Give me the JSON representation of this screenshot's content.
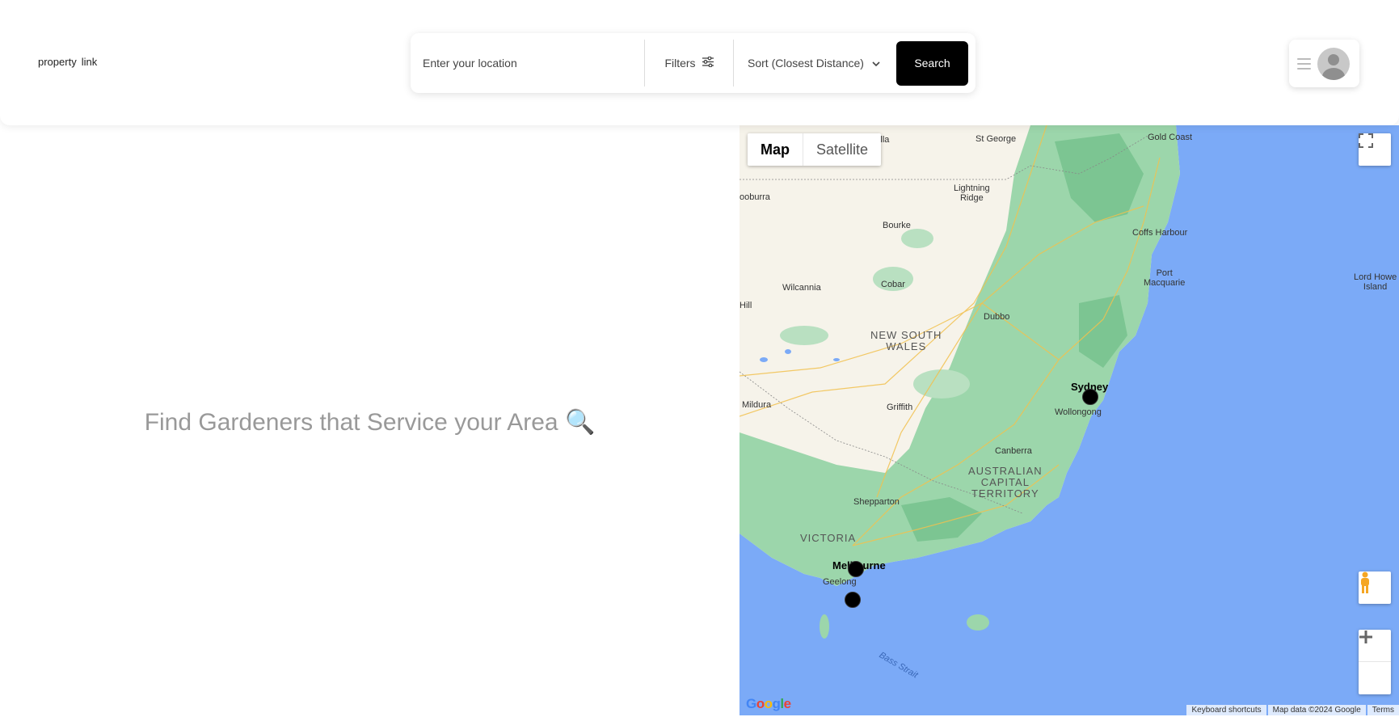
{
  "header": {
    "logo_word1": "property",
    "logo_word2": "link",
    "search_placeholder": "Enter your location",
    "filters_label": "Filters",
    "sort_label": "Sort (Closest Distance)",
    "search_button": "Search"
  },
  "main": {
    "tagline": "Find Gardeners that Service your Area 🔍"
  },
  "map": {
    "type_map": "Map",
    "type_satellite": "Satellite",
    "labels": {
      "gold_coast": "Gold Coast",
      "st_george": "St George",
      "cunnamulla": "amulla",
      "lightning_ridge": "Lightning\nRidge",
      "bourke": "Bourke",
      "coffs_harbour": "Coffs Harbour",
      "port_macquarie": "Port\nMacquarie",
      "lord_howe": "Lord Howe\nIsland",
      "wilcannia": "Wilcannia",
      "cobar": "Cobar",
      "dubbo": "Dubbo",
      "new_south_wales": "NEW SOUTH\nWALES",
      "sydney": "Sydney",
      "wollongong": "Wollongong",
      "mildura": "Mildura",
      "griffith": "Griffith",
      "canberra": "Canberra",
      "act": "AUSTRALIAN\nCAPITAL\nTERRITORY",
      "shepparton": "Shepparton",
      "victoria": "VICTORIA",
      "melbourne": "Melbourne",
      "geelong": "Geelong",
      "bass_strait": "Bass Strait",
      "thargomindah": "ooburra",
      "broken_hill": "Hill"
    },
    "attribution": {
      "shortcuts": "Keyboard shortcuts",
      "data": "Map data ©2024 Google",
      "terms": "Terms"
    },
    "google_logo": "Google"
  },
  "colors": {
    "ocean": "#7baaf7",
    "land": "#f6f3ea",
    "green": "#9cd6ab",
    "marker": "#000000",
    "search_button_bg": "#000000"
  }
}
